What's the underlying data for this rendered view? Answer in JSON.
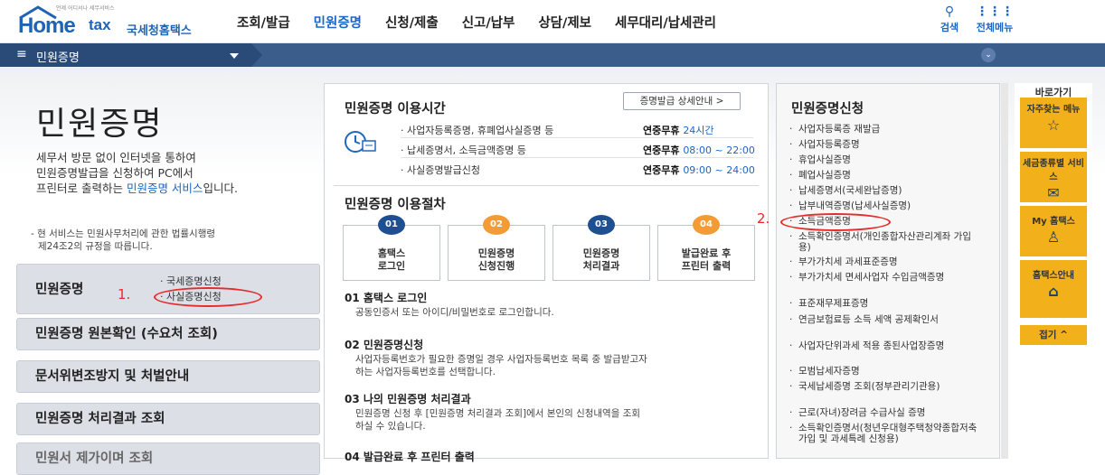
{
  "header": {
    "logo_tagline": "언제 어디서나 세무서비스",
    "logo_home": "Home",
    "logo_tax": "tax",
    "logo_sub": "국세청홈택스",
    "nav": [
      "조회/발급",
      "민원증명",
      "신청/제출",
      "신고/납부",
      "상담/제보",
      "세무대리/납세관리"
    ],
    "active_nav": "민원증명",
    "search_label": "검색",
    "allmenu_label": "전체메뉴"
  },
  "subnav": {
    "title": "민원증명"
  },
  "left": {
    "title": "민원증명",
    "intro_1": "세무서 방문 없이 인터넷을 통하여",
    "intro_2": "민원증명발급을 신청하여 PC에서",
    "intro_3a": "프린터로 출력하는 ",
    "intro_3b": "민원증명 서비스",
    "intro_3c": "입니다.",
    "note_1": "- 현 서비스는 민원사무처리에 관한 법률시행령",
    "note_2": "제24조2의 규정을 따릅니다.",
    "menu": {
      "main_label": "민원증명",
      "sub_1": "· 국세증명신청",
      "sub_2": "· 사실증명신청",
      "item_2": "민원증명 원본확인 (수요처 조회)",
      "item_3": "문서위변조방지 및 처벌안내",
      "item_4": "민원증명 처리결과 조회",
      "item_5": "민원서 제가이며 조회"
    },
    "annotation_1": "1."
  },
  "middle": {
    "hours_title": "민원증명 이용시간",
    "guide_button": "증명발급 상세안내 >",
    "hours": [
      {
        "label": "· 사업자등록증명, 휴폐업사실증명 등",
        "value": "연중무휴 ",
        "time": "24시간"
      },
      {
        "label": "· 납세증명서, 소득금액증명 등",
        "value": "연중무휴 ",
        "time": "08:00 ~ 22:00"
      },
      {
        "label": "· 사실증명발급신청",
        "value": "연중무휴 ",
        "time": "09:00 ~ 24:00"
      }
    ],
    "procedure_title": "민원증명 이용절차",
    "steps": [
      {
        "num": "01",
        "line1": "홈택스",
        "line2": "로그인"
      },
      {
        "num": "02",
        "line1": "민원증명",
        "line2": "신청진행"
      },
      {
        "num": "03",
        "line1": "민원증명",
        "line2": "처리결과"
      },
      {
        "num": "04",
        "line1": "발급완료 후",
        "line2": "프린터 출력"
      }
    ],
    "sections": [
      {
        "head": "01 홈택스 로그인",
        "body_1": "공동인증서 또는 아이디/비밀번호로 로그인합니다.",
        "body_2": ""
      },
      {
        "head": "02 민원증명신청",
        "body_1": "사업자등록번호가 필요한 증명일 경우 사업자등록번호 목록 중 발급받고자",
        "body_2": "하는 사업자등록번호를 선택합니다."
      },
      {
        "head": "03 나의 민원증명 처리결과",
        "body_1": "민원증명 신청 후 [민원증명 처리결과 조회]에서 본인의 신청내역을 조회",
        "body_2": "하실 수 있습니다."
      },
      {
        "head": "04 발급완료 후 프린터 출력",
        "body_1": "",
        "body_2": ""
      }
    ]
  },
  "right": {
    "title": "민원증명신청",
    "items": [
      "사업자등록증 재발급",
      "사업자등록증명",
      "휴업사실증명",
      "폐업사실증명",
      "납세증명서(국세완납증명)",
      "납부내역증명(납세사실증명)",
      "소득금액증명",
      "소득확인증명서(개인종합자산관리계좌 가입용)",
      "부가가치세 과세표준증명",
      "부가가치세 면세사업자 수입금액증명",
      "표준재무제표증명",
      "연금보험료등 소득 세액 공제확인서",
      "사업자단위과세 적용 종된사업장증명",
      "모범납세자증명",
      "국세납세증명 조회(정부관리기관용)",
      "근로(자녀)장려금 수급사실 증명",
      "소득확인증명서(청년우대형주택청약종합저축 가입 및 과세특례 신청용)"
    ],
    "annotation_2": "2."
  },
  "quick": {
    "title": "바로가기",
    "boxes": [
      {
        "label": "자주찾는 메뉴",
        "icon": "☆"
      },
      {
        "label": "세금종류별 서비스",
        "icon": "✉"
      },
      {
        "label": "My 홈택스",
        "icon": "♙"
      },
      {
        "label": "홈택스안내",
        "icon": "⌂"
      }
    ],
    "close": "접기 ^"
  },
  "colors": {
    "brand": "#1d66c2",
    "subnav": "#3b5d8c",
    "annotation": "#e52b2b",
    "quick": "#f2b01a",
    "step_orange": "#f39c36"
  }
}
